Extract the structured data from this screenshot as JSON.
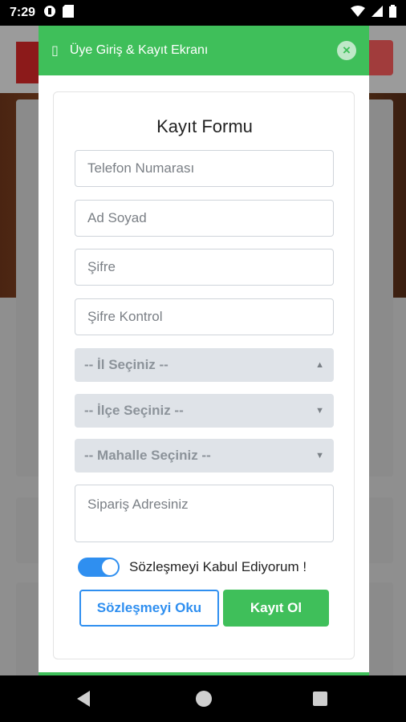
{
  "status_bar": {
    "time": "7:29",
    "icons": [
      "notification-icon",
      "sd-card-icon",
      "wifi-icon",
      "signal-icon",
      "battery-icon"
    ]
  },
  "modal": {
    "header_title": "Üye Giriş & Kayıt Ekranı",
    "header_color": "#3fbf5a",
    "close_symbol": "×"
  },
  "form": {
    "title": "Kayıt Formu",
    "phone_placeholder": "Telefon Numarası",
    "name_placeholder": "Ad Soyad",
    "password_placeholder": "Şifre",
    "password_confirm_placeholder": "Şifre Kontrol",
    "province_select": "-- İl Seçiniz --",
    "district_select": "-- İlçe Seçiniz --",
    "neighborhood_select": "-- Mahalle Seçiniz --",
    "address_placeholder": "Sipariş Adresiniz",
    "agreement_toggle_on": true,
    "agreement_label": "Sözleşmeyi Kabul Ediyorum !",
    "read_agreement_button": "Sözleşmeyi Oku",
    "register_button": "Kayıt Ol",
    "accent_blue": "#2f8ff0"
  }
}
